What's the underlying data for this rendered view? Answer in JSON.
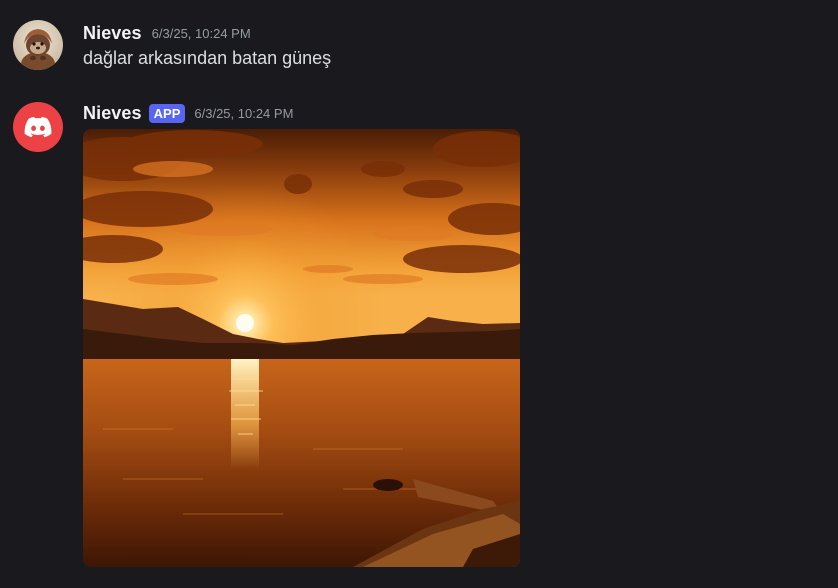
{
  "messages": [
    {
      "author": "Nieves",
      "timestamp": "6/3/25, 10:24 PM",
      "text": "dağlar arkasından batan güneş"
    },
    {
      "author": "Nieves",
      "badge": "APP",
      "timestamp": "6/3/25, 10:24 PM",
      "attachment_icon": "sunset-image"
    }
  ],
  "colors": {
    "background": "#1a1a1e",
    "username": "#f2f3f5",
    "timestamp": "#949ba4",
    "message_text": "#dbdee1",
    "app_badge": "#5865f2",
    "bot_avatar": "#ed4245"
  }
}
